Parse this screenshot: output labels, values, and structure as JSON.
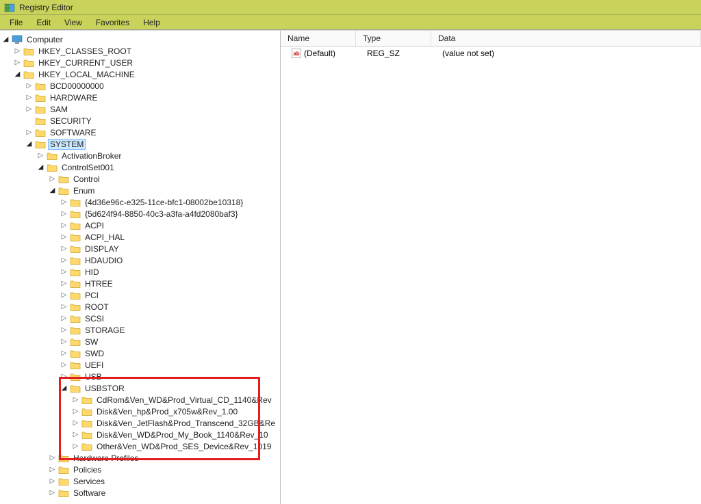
{
  "window": {
    "title": "Registry Editor"
  },
  "menu": {
    "file": "File",
    "edit": "Edit",
    "view": "View",
    "favorites": "Favorites",
    "help": "Help"
  },
  "columns": {
    "name": "Name",
    "type": "Type",
    "data": "Data"
  },
  "rows": [
    {
      "icon": "ab",
      "name": "(Default)",
      "type": "REG_SZ",
      "data": "(value not set)"
    }
  ],
  "tree": {
    "root": {
      "label": "Computer",
      "icon": "pc",
      "expanded": true
    },
    "hkcr": {
      "label": "HKEY_CLASSES_ROOT"
    },
    "hkcu": {
      "label": "HKEY_CURRENT_USER"
    },
    "hklm": {
      "label": "HKEY_LOCAL_MACHINE",
      "expanded": true
    },
    "bcd": {
      "label": "BCD00000000"
    },
    "hardware": {
      "label": "HARDWARE"
    },
    "sam": {
      "label": "SAM"
    },
    "security": {
      "label": "SECURITY"
    },
    "software": {
      "label": "SOFTWARE"
    },
    "system": {
      "label": "SYSTEM",
      "expanded": true,
      "selected": true
    },
    "activationbroker": {
      "label": "ActivationBroker"
    },
    "controlset001": {
      "label": "ControlSet001",
      "expanded": true
    },
    "control": {
      "label": "Control"
    },
    "enum": {
      "label": "Enum",
      "expanded": true
    },
    "guid1": {
      "label": "{4d36e96c-e325-11ce-bfc1-08002be10318}"
    },
    "guid2": {
      "label": "{5d624f94-8850-40c3-a3fa-a4fd2080baf3}"
    },
    "acpi": {
      "label": "ACPI"
    },
    "acpihal": {
      "label": "ACPI_HAL"
    },
    "display": {
      "label": "DISPLAY"
    },
    "hdaudio": {
      "label": "HDAUDIO"
    },
    "hid": {
      "label": "HID"
    },
    "htree": {
      "label": "HTREE"
    },
    "pci": {
      "label": "PCI"
    },
    "rroot": {
      "label": "ROOT"
    },
    "scsi": {
      "label": "SCSI"
    },
    "storage": {
      "label": "STORAGE"
    },
    "sw": {
      "label": "SW"
    },
    "swd": {
      "label": "SWD"
    },
    "uefi": {
      "label": "UEFI"
    },
    "usb": {
      "label": "USB"
    },
    "usbstor": {
      "label": "USBSTOR",
      "expanded": true
    },
    "ustor1": {
      "label": "CdRom&Ven_WD&Prod_Virtual_CD_1140&Rev"
    },
    "ustor2": {
      "label": "Disk&Ven_hp&Prod_x705w&Rev_1.00"
    },
    "ustor3": {
      "label": "Disk&Ven_JetFlash&Prod_Transcend_32GB&Re"
    },
    "ustor4": {
      "label": "Disk&Ven_WD&Prod_My_Book_1140&Rev_10"
    },
    "ustor5": {
      "label": "Other&Ven_WD&Prod_SES_Device&Rev_1019"
    },
    "hwprofiles": {
      "label": "Hardware Profiles"
    },
    "policies": {
      "label": "Policies"
    },
    "services": {
      "label": "Services"
    },
    "csoftware": {
      "label": "Software"
    }
  }
}
